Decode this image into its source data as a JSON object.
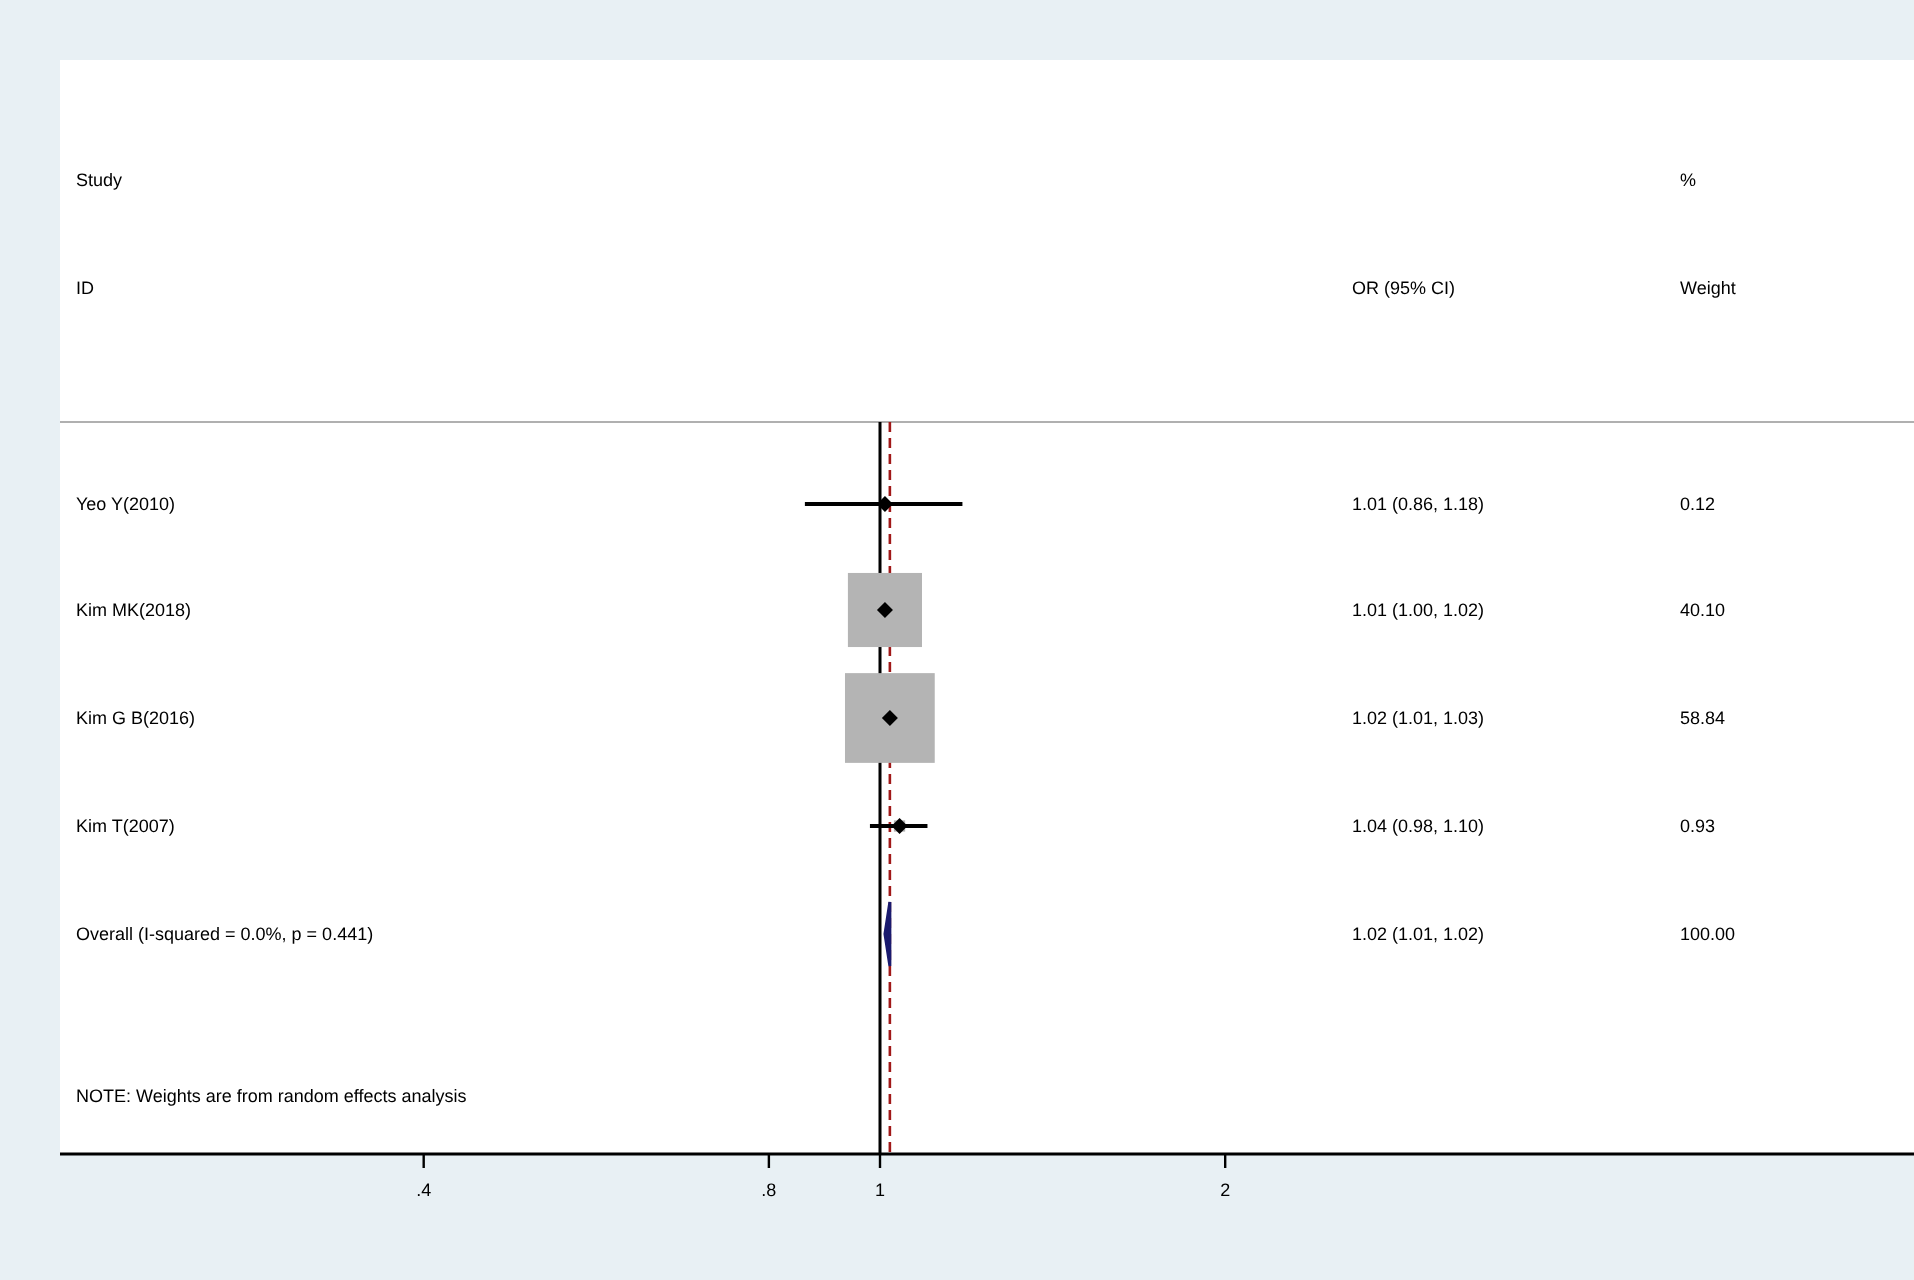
{
  "headers": [
    {
      "kind": "study",
      "lines": [
        "Study",
        "ID"
      ]
    },
    {
      "kind": "or",
      "lines": [
        "OR (95% CI)"
      ]
    },
    {
      "kind": "weight",
      "lines": [
        "%",
        "Weight"
      ]
    }
  ],
  "rows": [
    {
      "kind": "study",
      "label": "Yeo Y(2010)",
      "or_ci": "1.01 (0.86, 1.18)",
      "weight": "0.12"
    },
    {
      "kind": "study",
      "label": "Kim MK(2018)",
      "or_ci": "1.01 (1.00, 1.02)",
      "weight": "40.10"
    },
    {
      "kind": "study",
      "label": "Kim G B(2016)",
      "or_ci": "1.02 (1.01, 1.03)",
      "weight": "58.84"
    },
    {
      "kind": "study",
      "label": "Kim T(2007)",
      "or_ci": "1.04 (0.98, 1.10)",
      "weight": "0.93"
    },
    {
      "kind": "overall",
      "label": "Overall  (I-squared = 0.0%, p = 0.441)",
      "or_ci": "1.02 (1.01, 1.02)",
      "weight": "100.00"
    }
  ],
  "note": "NOTE: Weights are from random effects analysis",
  "axis_ticks": [
    ".4",
    ".8",
    "1",
    "2"
  ]
}
